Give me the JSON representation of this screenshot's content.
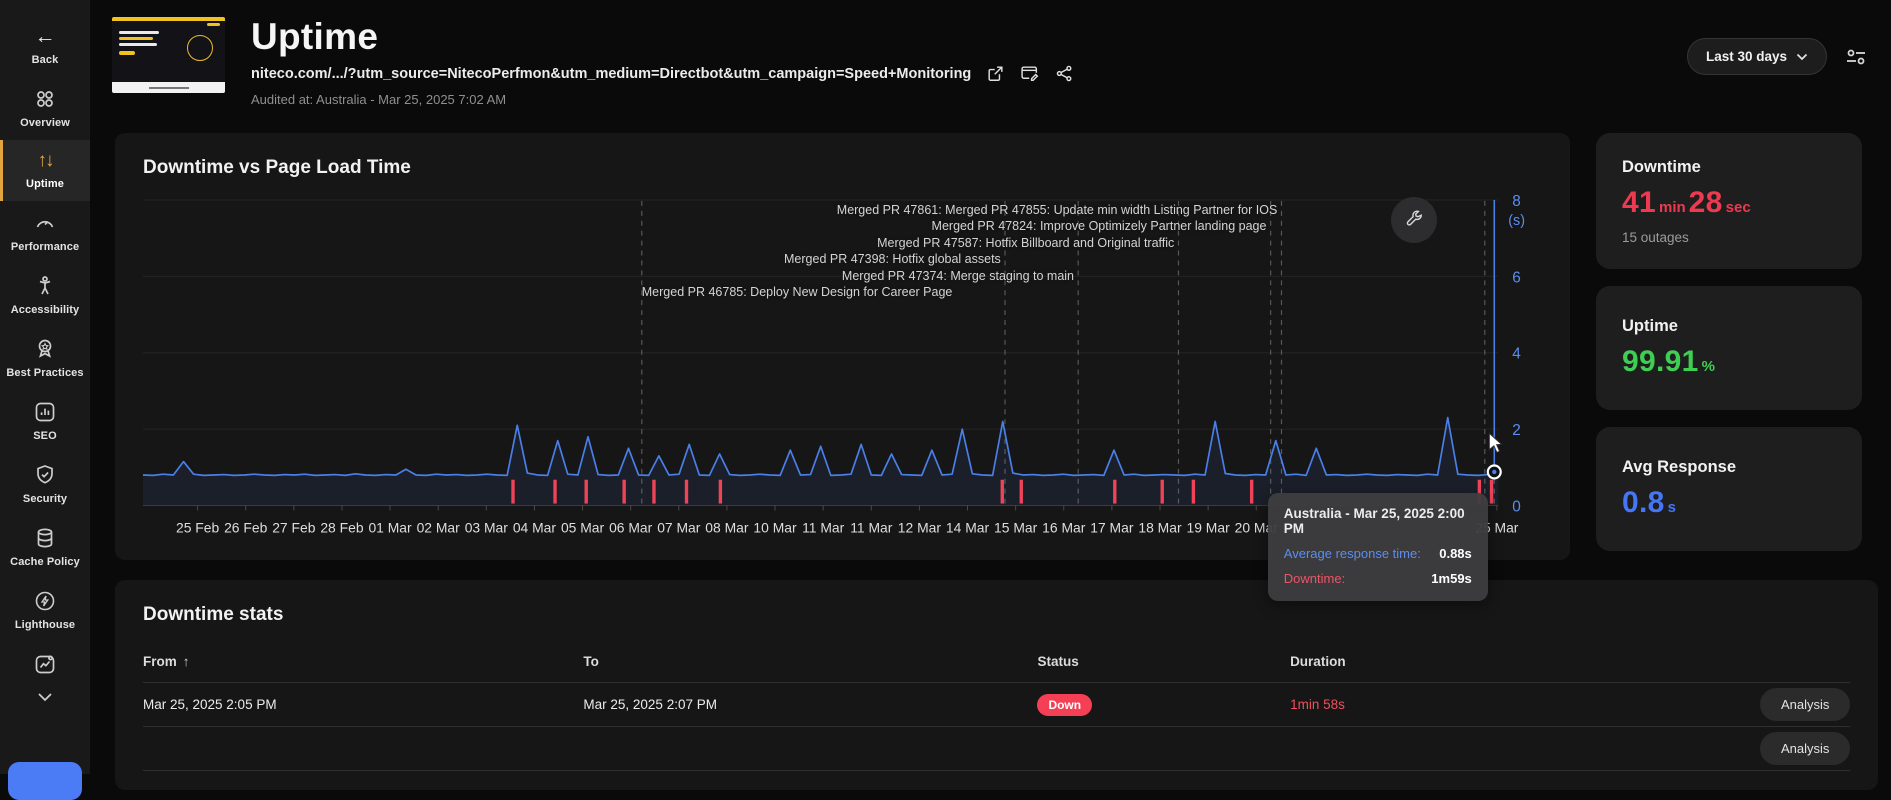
{
  "sidebar": {
    "back": "Back",
    "items": [
      {
        "label": "Overview"
      },
      {
        "label": "Uptime",
        "active": true
      },
      {
        "label": "Performance"
      },
      {
        "label": "Accessibility"
      },
      {
        "label": "Best Practices"
      },
      {
        "label": "SEO"
      },
      {
        "label": "Security"
      },
      {
        "label": "Cache Policy"
      },
      {
        "label": "Lighthouse"
      }
    ]
  },
  "header": {
    "title": "Uptime",
    "url": "niteco.com/.../?utm_source=NitecoPerfmon&utm_medium=Directbot&utm_campaign=Speed+Monitoring",
    "audited": "Audited at: Australia - Mar 25, 2025 7:02 AM",
    "range": "Last 30 days"
  },
  "chart_data": {
    "type": "line",
    "title": "Downtime vs Page Load Time",
    "ylabel": "(s)",
    "ylim": [
      0,
      8
    ],
    "yticks": [
      0,
      2,
      4,
      6,
      8
    ],
    "axis_color": "#5b8df0",
    "x_labels": [
      "25 Feb",
      "26 Feb",
      "27 Feb",
      "28 Feb",
      "01 Mar",
      "02 Mar",
      "03 Mar",
      "04 Mar",
      "05 Mar",
      "06 Mar",
      "07 Mar",
      "08 Mar",
      "10 Mar",
      "11 Mar",
      "11 Mar",
      "12 Mar",
      "14 Mar",
      "15 Mar",
      "16 Mar",
      "17 Mar",
      "18 Mar",
      "19 Mar",
      "20 Mar",
      "",
      "",
      "",
      "",
      "25 Mar"
    ],
    "series": [
      {
        "name": "Average response time",
        "color": "#4a7fe8",
        "values": [
          0.8,
          0.79,
          0.82,
          0.8,
          1.15,
          0.82,
          0.79,
          0.8,
          0.81,
          0.79,
          0.8,
          0.82,
          0.8,
          0.79,
          0.81,
          0.8,
          0.82,
          0.79,
          0.8,
          0.81,
          0.79,
          0.83,
          0.8,
          0.79,
          0.81,
          0.8,
          0.95,
          0.8,
          0.79,
          0.82,
          0.8,
          0.81,
          0.79,
          0.8,
          0.82,
          0.8,
          0.79,
          2.1,
          0.85,
          0.8,
          0.79,
          1.7,
          0.82,
          0.8,
          1.8,
          0.81,
          0.79,
          0.8,
          1.5,
          0.8,
          0.79,
          1.3,
          0.8,
          0.82,
          1.6,
          0.8,
          0.79,
          1.35,
          0.81,
          0.79,
          0.8,
          0.82,
          0.8,
          0.79,
          1.45,
          0.8,
          0.81,
          1.55,
          0.79,
          0.8,
          0.82,
          1.6,
          0.8,
          0.79,
          1.35,
          0.81,
          0.8,
          0.79,
          1.45,
          0.8,
          0.82,
          2.0,
          0.83,
          0.8,
          0.79,
          2.2,
          0.85,
          0.8,
          0.81,
          0.79,
          0.8,
          0.82,
          0.79,
          0.8,
          0.81,
          0.79,
          1.45,
          0.8,
          0.82,
          0.79,
          0.8,
          0.81,
          0.8,
          0.79,
          0.82,
          0.8,
          2.2,
          0.84,
          0.8,
          0.79,
          0.81,
          0.8,
          1.7,
          0.8,
          0.82,
          0.79,
          1.5,
          0.8,
          0.81,
          0.79,
          0.8,
          0.82,
          0.8,
          0.79,
          0.81,
          0.8,
          0.79,
          0.82,
          0.8,
          2.3,
          0.82,
          0.8,
          0.79,
          0.81,
          0.88
        ]
      }
    ],
    "downtime_color": "#ef4458",
    "downtime_events_pct": [
      27.3,
      30.4,
      32.7,
      35.5,
      37.7,
      40.1,
      42.6,
      63.4,
      64.8,
      71.7,
      75.2,
      77.5,
      81.8,
      98.6,
      99.5
    ],
    "deployments": [
      {
        "label": "Merged PR 47861: Merged PR 47855: Update min width Listing Partner for IOS",
        "x_pct": 84.0,
        "align": "right"
      },
      {
        "label": "Merged PR 47824: Improve Optimizely Partner landing page",
        "x_pct": 83.2,
        "align": "right"
      },
      {
        "label": "Merged PR 47587: Hotfix Billboard and Original traffic",
        "x_pct": 76.4,
        "align": "right"
      },
      {
        "label": "Merged PR 47398: Hotfix global assets",
        "x_pct": 63.6,
        "align": "right"
      },
      {
        "label": "Merged PR 47374: Merge staging to main",
        "x_pct": 69.0,
        "align": "right"
      },
      {
        "label": "Merged PR 46785: Deploy New Design for Career Page",
        "x_pct": 36.8,
        "align": "left"
      }
    ],
    "extra_marker_lines_pct": [
      99.0,
      99.7
    ],
    "hover": {
      "x_pct": 99.7,
      "value": 0.88
    },
    "tooltip": {
      "title": "Australia - Mar 25, 2025 2:00 PM",
      "rows": [
        {
          "label": "Average response time:",
          "value": "0.88s",
          "color": "#5b8df0"
        },
        {
          "label": "Downtime:",
          "value": "1m59s",
          "color": "#ef5466"
        }
      ]
    }
  },
  "cards": {
    "downtime": {
      "title": "Downtime",
      "v1": "41",
      "u1": "min",
      "v2": "28",
      "u2": "sec",
      "subtitle": "15 outages",
      "color": "#ee3a50"
    },
    "uptime": {
      "title": "Uptime",
      "value": "99.91",
      "unit": "%",
      "color": "#3ecf52"
    },
    "avg_response": {
      "title": "Avg Response",
      "value": "0.8",
      "unit": "s",
      "color": "#4576f5"
    }
  },
  "table": {
    "title": "Downtime stats",
    "columns": [
      "From",
      "To",
      "Status",
      "Duration"
    ],
    "sort_column": "From",
    "rows": [
      {
        "from": "Mar 25, 2025 2:05 PM",
        "to": "Mar 25, 2025 2:07 PM",
        "status": "Down",
        "duration": "1min 58s",
        "action": "Analysis"
      },
      {
        "from": "",
        "to": "",
        "status": "",
        "duration": "",
        "action": "Analysis"
      }
    ]
  }
}
